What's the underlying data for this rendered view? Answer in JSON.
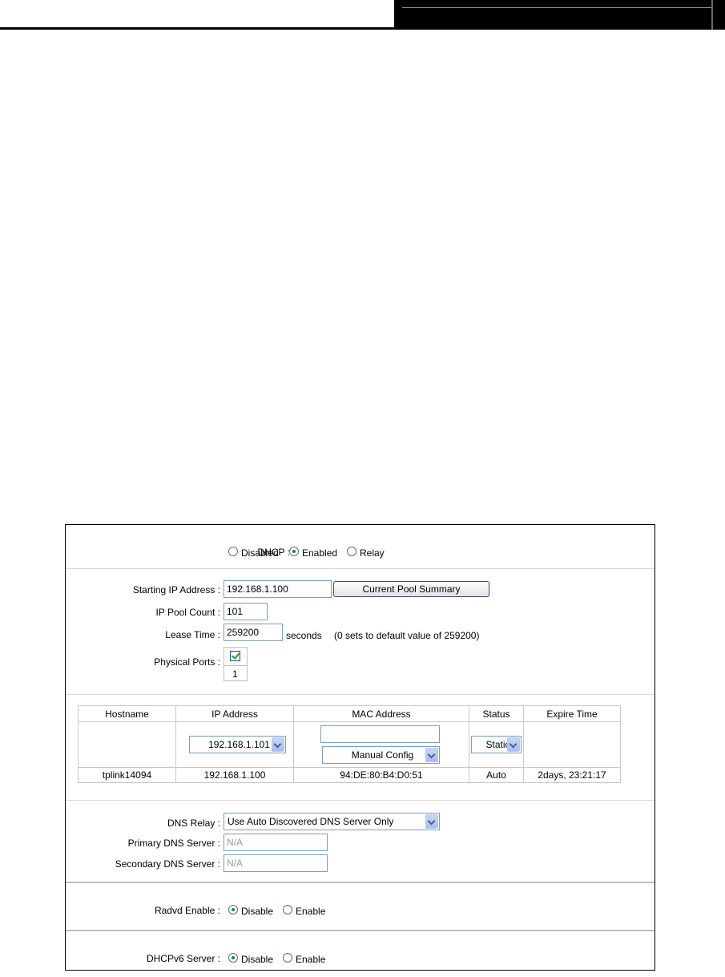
{
  "dhcp": {
    "label": "DHCP :",
    "options": [
      {
        "label": "Disabled",
        "selected": false
      },
      {
        "label": "Enabled",
        "selected": true
      },
      {
        "label": "Relay",
        "selected": false
      }
    ]
  },
  "pool": {
    "start_label": "Starting IP Address :",
    "start_value": "192.168.1.100",
    "summary_button": "Current Pool Summary",
    "count_label": "IP Pool Count :",
    "count_value": "101",
    "lease_label": "Lease Time :",
    "lease_value": "259200",
    "lease_unit": "seconds",
    "lease_note": "(0 sets to default value of 259200)",
    "ports_label": "Physical Ports :",
    "port_number": "1"
  },
  "leases": {
    "headers": [
      "Hostname",
      "IP Address",
      "MAC Address",
      "Status",
      "Expire Time"
    ],
    "new_row": {
      "ip_select": "192.168.1.101",
      "mac_input": "",
      "mac_select": "Manual Config",
      "status_select": "Static"
    },
    "rows": [
      {
        "hostname": "tplink14094",
        "ip": "192.168.1.100",
        "mac": "94:DE:80:B4:D0:51",
        "status": "Auto",
        "expire": "2days, 23:21:17"
      }
    ]
  },
  "dns": {
    "relay_label": "DNS Relay :",
    "relay_value": "Use Auto Discovered DNS Server Only",
    "primary_label": "Primary DNS Server :",
    "primary_value": "N/A",
    "secondary_label": "Secondary DNS Server :",
    "secondary_value": "N/A"
  },
  "radvd": {
    "label": "Radvd Enable :",
    "options": [
      {
        "label": "Disable",
        "selected": true
      },
      {
        "label": "Enable",
        "selected": false
      }
    ]
  },
  "dhcpv6": {
    "label": "DHCPv6 Server :",
    "options": [
      {
        "label": "Disable",
        "selected": true
      },
      {
        "label": "Enable",
        "selected": false
      }
    ]
  },
  "colors": {
    "frame_border": "#000000",
    "input_border": "#7f9db9",
    "radio_dot": "#1f8a1f",
    "check_mark": "#21a121"
  }
}
